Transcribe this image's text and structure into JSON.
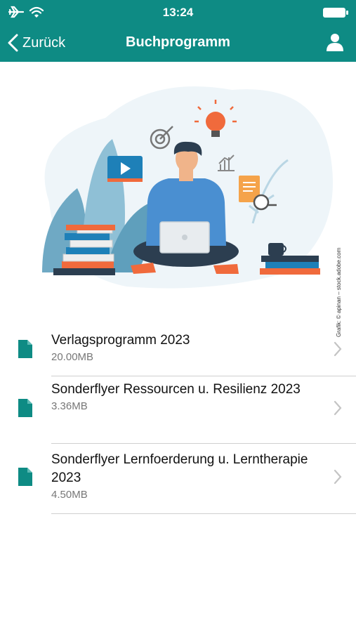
{
  "status_bar": {
    "time": "13:24"
  },
  "nav": {
    "back_label": "Zurück",
    "title": "Buchprogramm"
  },
  "hero": {
    "credit": "Grafik: © apinan – stock.adobe.com"
  },
  "documents": [
    {
      "name": "Verlagsprogramm 2023",
      "size": "20.00MB"
    },
    {
      "name": "Sonderflyer Ressourcen u. Resilienz 2023",
      "size": "3.36MB"
    },
    {
      "name": "Sonderflyer Lernfoerderung u. Lerntherapie 2023",
      "size": "4.50MB"
    }
  ],
  "colors": {
    "header": "#0e8b84",
    "doc_icon": "#0e8b84",
    "separator": "#cfcfcf"
  }
}
